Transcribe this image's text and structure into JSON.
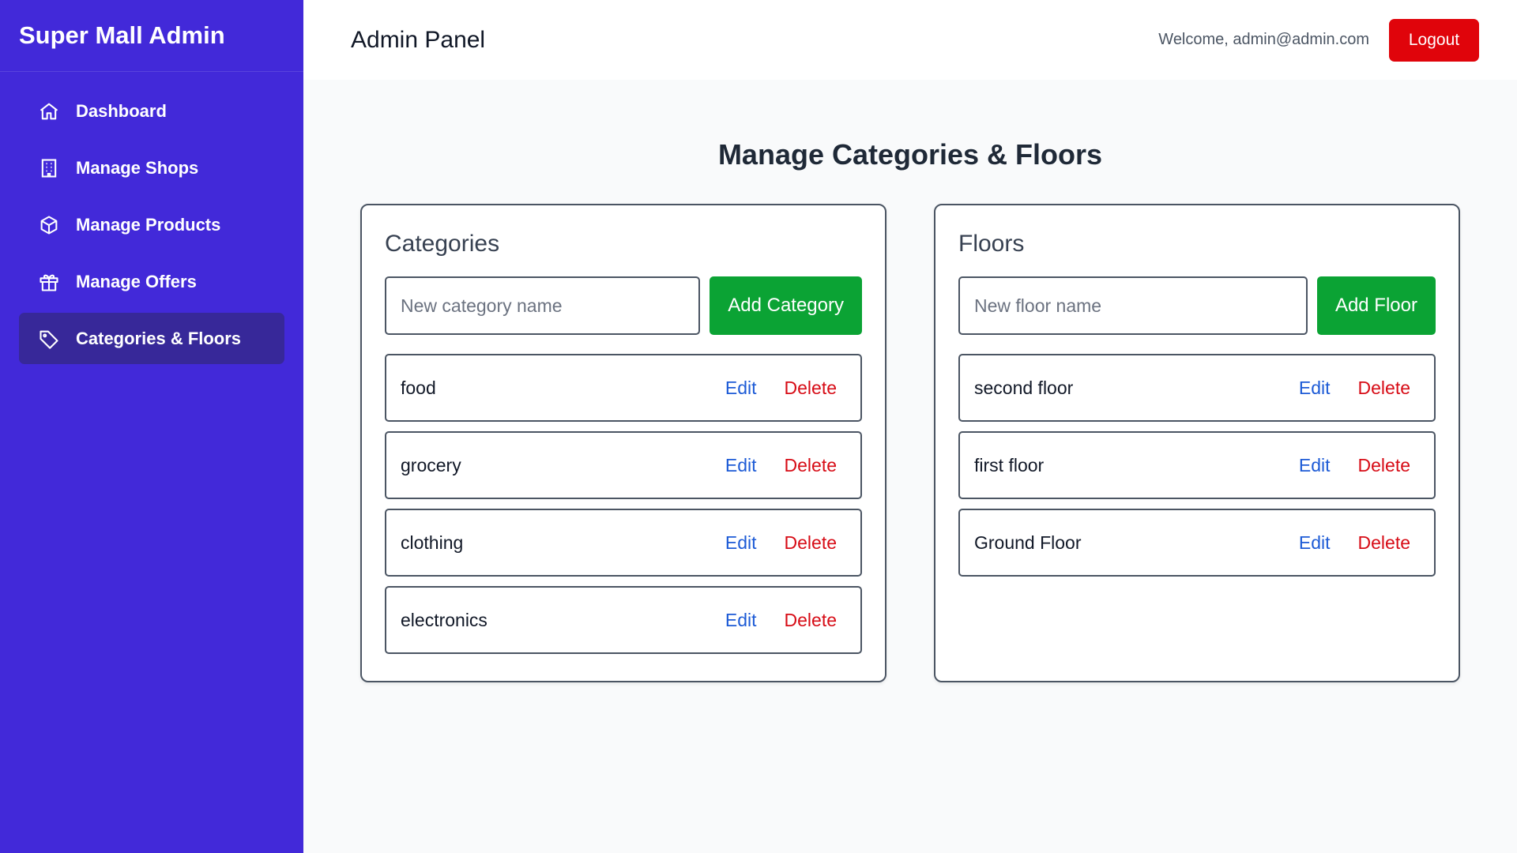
{
  "sidebar": {
    "brand": "Super Mall Admin",
    "items": [
      {
        "label": "Dashboard",
        "icon": "home-icon"
      },
      {
        "label": "Manage Shops",
        "icon": "building-icon"
      },
      {
        "label": "Manage Products",
        "icon": "box-icon"
      },
      {
        "label": "Manage Offers",
        "icon": "gift-icon"
      },
      {
        "label": "Categories & Floors",
        "icon": "tag-icon",
        "active": true
      }
    ]
  },
  "header": {
    "title": "Admin Panel",
    "welcome": "Welcome, admin@admin.com",
    "logout_label": "Logout"
  },
  "main": {
    "title": "Manage Categories & Floors",
    "categories": {
      "heading": "Categories",
      "input_placeholder": "New category name",
      "add_label": "Add Category",
      "items": [
        "food",
        "grocery",
        "clothing",
        "electronics"
      ]
    },
    "floors": {
      "heading": "Floors",
      "input_placeholder": "New floor name",
      "add_label": "Add Floor",
      "items": [
        "second floor",
        "first floor",
        "Ground Floor"
      ]
    },
    "edit_label": "Edit",
    "delete_label": "Delete"
  },
  "colors": {
    "sidebar_bg": "#4229d9",
    "active_item_bg": "#372899",
    "logout": "#e0040b",
    "add_button": "#0ba334",
    "edit": "#1d5bd6",
    "delete": "#d70c16"
  }
}
